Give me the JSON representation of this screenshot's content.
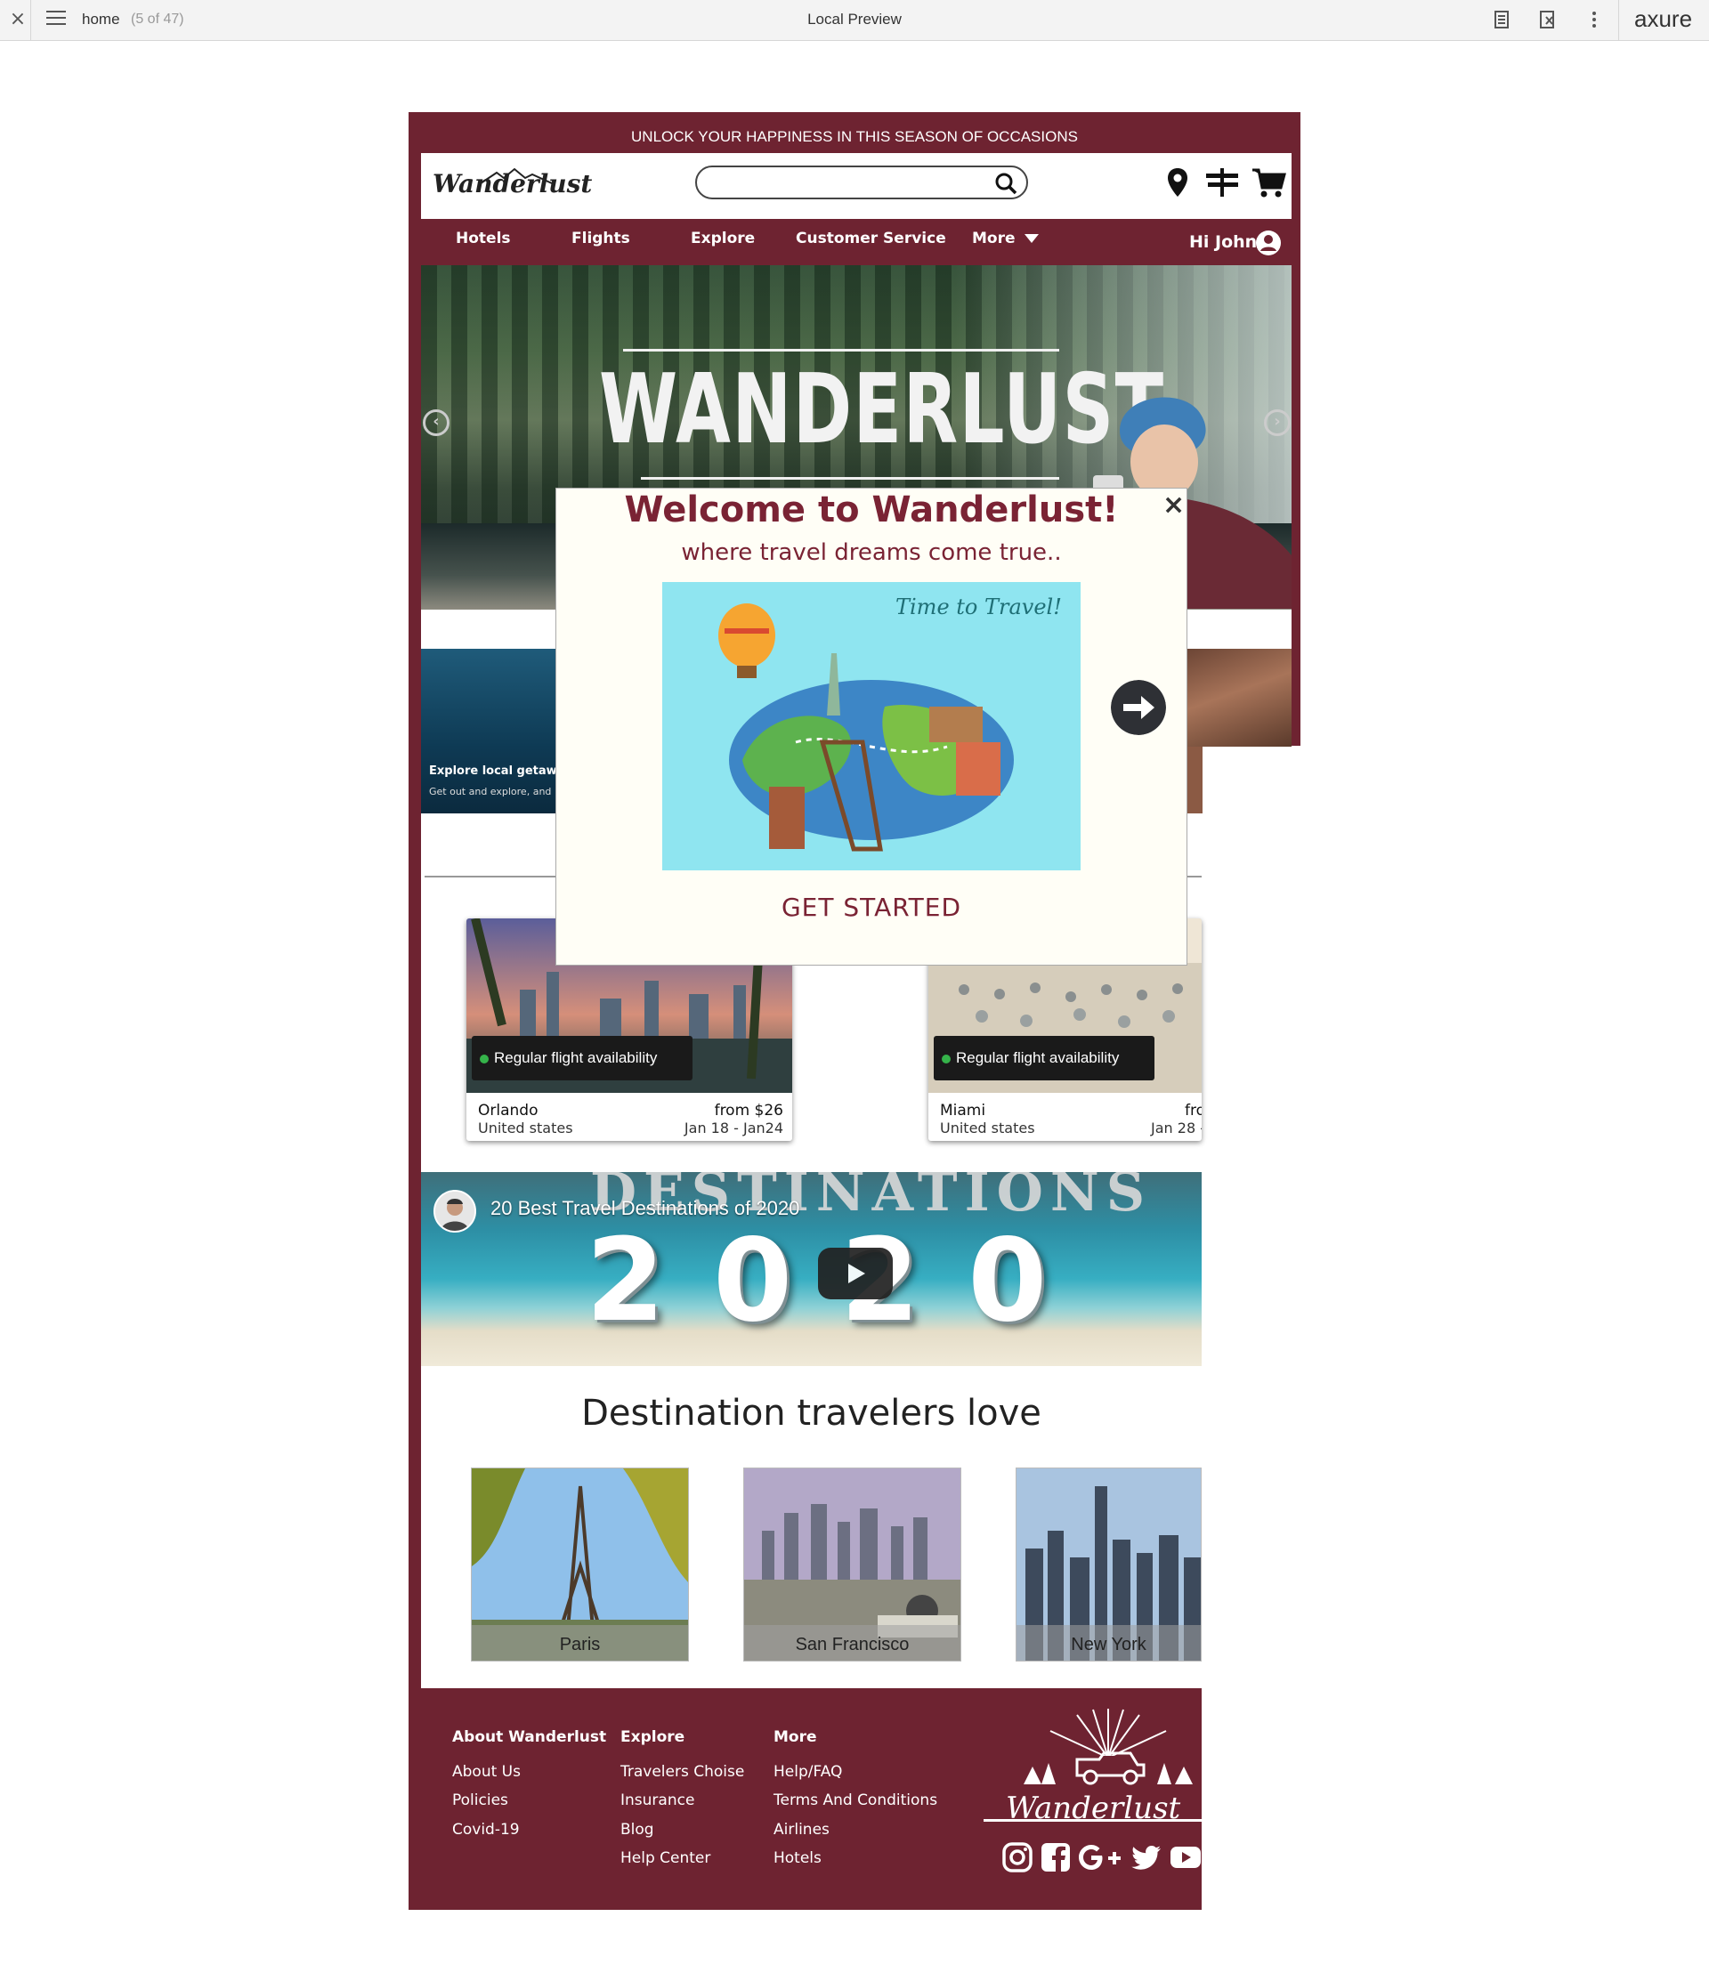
{
  "viewer": {
    "page_name": "home",
    "page_count": "(5 of 47)",
    "title": "Local Preview",
    "brand": "axure"
  },
  "site": {
    "promo": "UNLOCK YOUR HAPPINESS IN THIS SEASON OF OCCASIONS",
    "logo": "Wanderlust",
    "search": {
      "value": "",
      "placeholder": ""
    },
    "nav": [
      "Hotels",
      "Flights",
      "Explore",
      "Customer Service",
      "More"
    ],
    "greeting": "Hi John",
    "hero_title": "WANDERLUST",
    "side_card": {
      "title": "Explore local getawa",
      "subtitle": "Get out and explore, and"
    },
    "flights": [
      {
        "badge": "Regular flight availability",
        "city": "Orlando",
        "country": "United states",
        "price": "from $26",
        "dates": "Jan 18 - Jan24"
      },
      {
        "badge": "Regular flight availability",
        "city": "Miami",
        "country": "United states",
        "price": "fro",
        "dates": "Jan 28 -"
      }
    ],
    "video": {
      "title": "20 Best Travel Destinations of 2020",
      "word": "DESTINATIONS",
      "year": "2020"
    },
    "destinations_heading": "Destination travelers love",
    "destinations": [
      "Paris",
      "San Francisco",
      "New York"
    ],
    "footer": {
      "col1": {
        "heading": "About Wanderlust",
        "links": [
          "About Us",
          "Policies",
          "Covid-19"
        ]
      },
      "col2": {
        "heading": "Explore",
        "links": [
          "Travelers Choise",
          "Insurance",
          "Blog",
          "Help Center"
        ]
      },
      "col3": {
        "heading": "More",
        "links": [
          "Help/FAQ",
          "Terms And Conditions",
          "Airlines",
          "Hotels"
        ]
      },
      "logo": "Wanderlust",
      "social": [
        "instagram-icon",
        "facebook-icon",
        "google-plus-icon",
        "twitter-icon",
        "youtube-icon"
      ]
    }
  },
  "modal": {
    "title": "Welcome to Wanderlust!",
    "subtitle": "where travel dreams come true..",
    "image_caption": "Time to Travel!",
    "cta": "GET STARTED"
  },
  "colors": {
    "brand": "#6e2331",
    "accent": "#7a2334",
    "badge_dot": "#35b34a"
  }
}
